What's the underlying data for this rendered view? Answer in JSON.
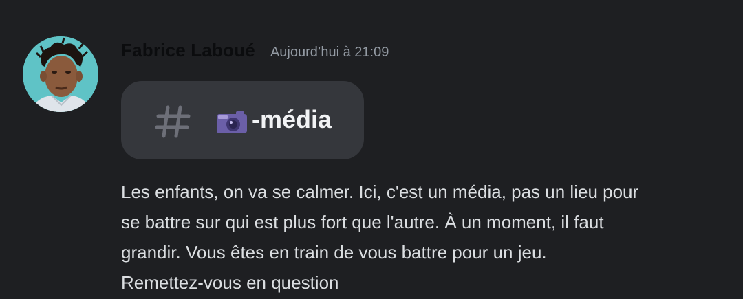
{
  "message": {
    "author": "Fabrice Laboué",
    "timestamp": "Aujourd’hui à 21:09",
    "avatar_icon": "user-avatar",
    "channel_mention": {
      "icon": "hash-icon",
      "emoji": "camera-icon",
      "name": "-média"
    },
    "text_lines": [
      "Les enfants, on va se calmer. Ici, c'est un média, pas un lieu pour",
      "se battre sur qui est plus fort que l'autre. À un moment, il faut",
      "grandir. Vous êtes en train de vous battre pour un jeu.",
      "Remettez-vous en question"
    ]
  },
  "colors": {
    "background": "#1e1f22",
    "pill": "#35373c",
    "text": "#dbdee1",
    "muted": "#949ba4"
  }
}
